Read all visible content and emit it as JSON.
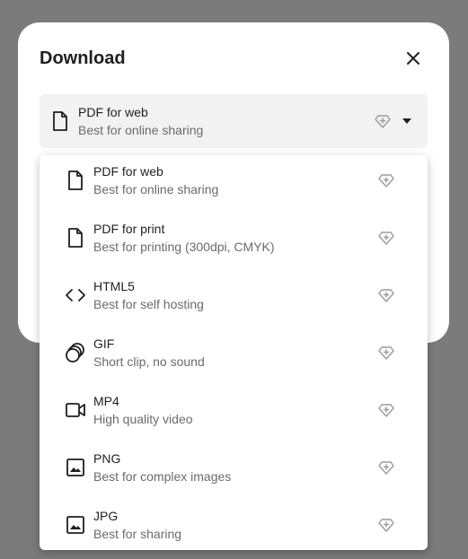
{
  "dialog": {
    "title": "Download"
  },
  "select": {
    "selected_title": "PDF for web",
    "selected_subtitle": "Best for online sharing"
  },
  "options": [
    {
      "title": "PDF for web",
      "subtitle": "Best for online sharing",
      "icon": "document-icon"
    },
    {
      "title": "PDF for print",
      "subtitle": "Best for printing (300dpi, CMYK)",
      "icon": "document-icon"
    },
    {
      "title": "HTML5",
      "subtitle": "Best for self hosting",
      "icon": "code-icon"
    },
    {
      "title": "GIF",
      "subtitle": "Short clip, no sound",
      "icon": "gif-circles-icon"
    },
    {
      "title": "MP4",
      "subtitle": "High quality video",
      "icon": "video-camera-icon"
    },
    {
      "title": "PNG",
      "subtitle": "Best for complex images",
      "icon": "image-icon"
    },
    {
      "title": "JPG",
      "subtitle": "Best for sharing",
      "icon": "image-icon"
    }
  ],
  "colors": {
    "backdrop": "#7b7b7b",
    "surface": "#ffffff",
    "select_background": "#f2f2f2",
    "primary_text": "#1f1f1f",
    "secondary_text": "#6b6b6b",
    "premium_icon": "#9a9a9a"
  }
}
